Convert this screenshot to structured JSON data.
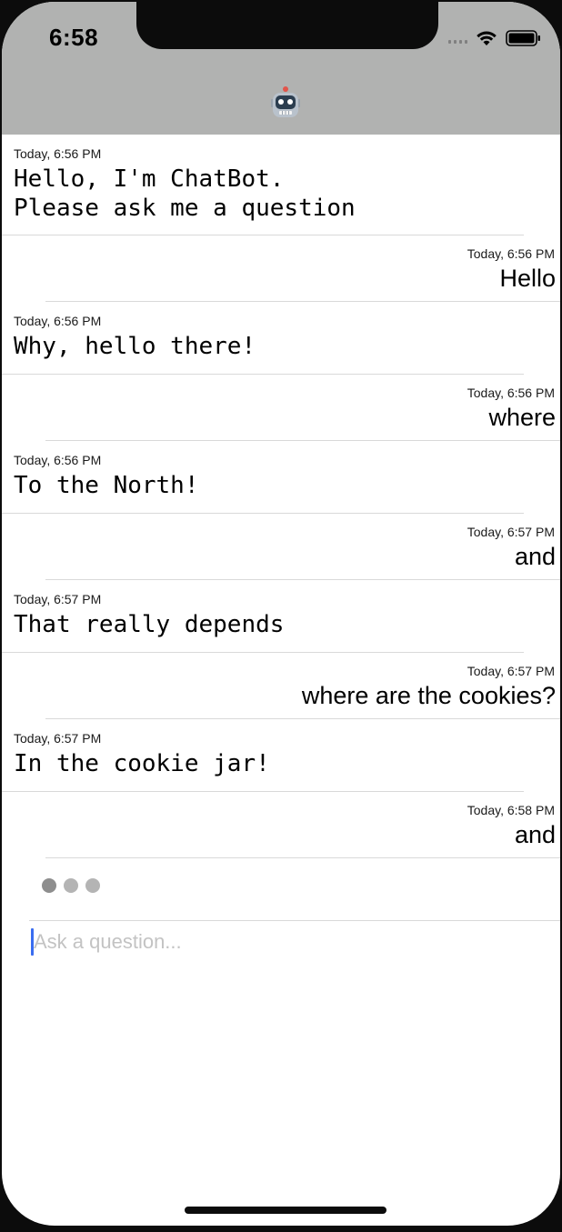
{
  "status_bar": {
    "time": "6:58"
  },
  "header": {
    "avatar_icon": "robot-face-icon"
  },
  "messages": [
    {
      "sender": "bot",
      "timestamp": "Today, 6:56 PM",
      "text": "Hello, I'm ChatBot.\nPlease ask me a question"
    },
    {
      "sender": "user",
      "timestamp": "Today, 6:56 PM",
      "text": "Hello"
    },
    {
      "sender": "bot",
      "timestamp": "Today, 6:56 PM",
      "text": "Why, hello there!"
    },
    {
      "sender": "user",
      "timestamp": "Today, 6:56 PM",
      "text": "where"
    },
    {
      "sender": "bot",
      "timestamp": "Today, 6:56 PM",
      "text": "To the North!"
    },
    {
      "sender": "user",
      "timestamp": "Today, 6:57 PM",
      "text": "and"
    },
    {
      "sender": "bot",
      "timestamp": "Today, 6:57 PM",
      "text": "That really depends"
    },
    {
      "sender": "user",
      "timestamp": "Today, 6:57 PM",
      "text": "where are the cookies?"
    },
    {
      "sender": "bot",
      "timestamp": "Today, 6:57 PM",
      "text": "In the cookie jar!"
    },
    {
      "sender": "user",
      "timestamp": "Today, 6:58 PM",
      "text": "and"
    }
  ],
  "composer": {
    "placeholder": "Ask a question...",
    "value": ""
  },
  "colors": {
    "header_bg": "#b1b2b1",
    "caret": "#3a6df0",
    "divider": "#d9d9d9"
  }
}
